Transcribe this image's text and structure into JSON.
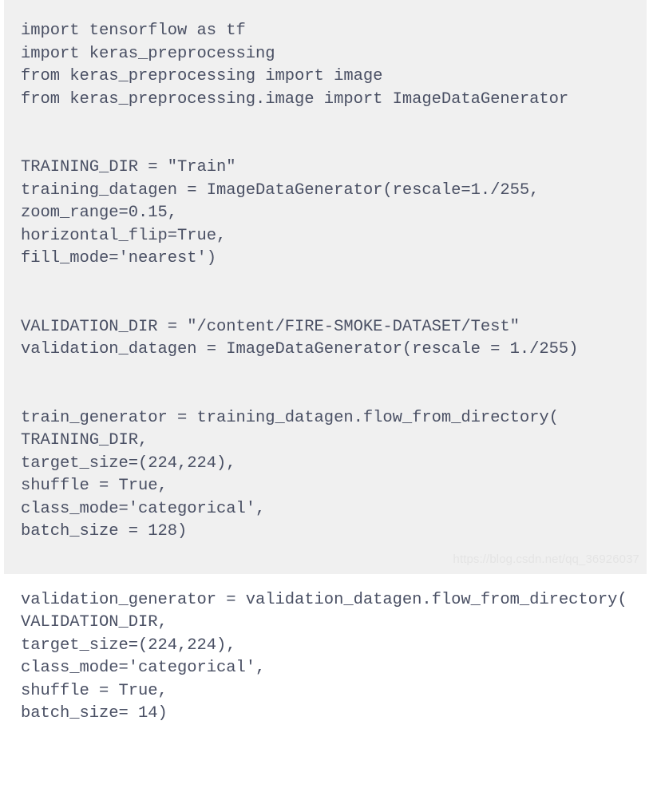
{
  "document": {
    "type": "code-snippet",
    "language": "python",
    "background_color": "#f0f0f0",
    "text_color": "#4a5064",
    "code_lines": [
      "import tensorflow as tf",
      "import keras_preprocessing",
      "from keras_preprocessing import image",
      "from keras_preprocessing.image import ImageDataGenerator",
      "",
      "",
      "TRAINING_DIR = \"Train\"",
      "training_datagen = ImageDataGenerator(rescale=1./255,",
      "zoom_range=0.15,",
      "horizontal_flip=True,",
      "fill_mode='nearest')",
      "",
      "",
      "VALIDATION_DIR = \"/content/FIRE-SMOKE-DATASET/Test\"",
      "validation_datagen = ImageDataGenerator(rescale = 1./255)",
      "",
      "",
      "train_generator = training_datagen.flow_from_directory(",
      "TRAINING_DIR,",
      "target_size=(224,224),",
      "shuffle = True,",
      "class_mode='categorical',",
      "batch_size = 128)",
      "",
      "",
      "validation_generator = validation_datagen.flow_from_directory(",
      "VALIDATION_DIR,",
      "target_size=(224,224),",
      "class_mode='categorical',",
      "shuffle = True,",
      "batch_size= 14)"
    ],
    "code_text": "import tensorflow as tf\nimport keras_preprocessing\nfrom keras_preprocessing import image\nfrom keras_preprocessing.image import ImageDataGenerator\n\n\nTRAINING_DIR = \"Train\"\ntraining_datagen = ImageDataGenerator(rescale=1./255,\nzoom_range=0.15,\nhorizontal_flip=True,\nfill_mode='nearest')\n\n\nVALIDATION_DIR = \"/content/FIRE-SMOKE-DATASET/Test\"\nvalidation_datagen = ImageDataGenerator(rescale = 1./255)\n\n\ntrain_generator = training_datagen.flow_from_directory(\nTRAINING_DIR,\ntarget_size=(224,224),\nshuffle = True,\nclass_mode='categorical',\nbatch_size = 128)\n\n\nvalidation_generator = validation_datagen.flow_from_directory(\nVALIDATION_DIR,\ntarget_size=(224,224),\nclass_mode='categorical',\nshuffle = True,\nbatch_size= 14)"
  },
  "watermark": {
    "text": "https://blog.csdn.net/qq_36926037",
    "color": "#e4e4e4"
  }
}
